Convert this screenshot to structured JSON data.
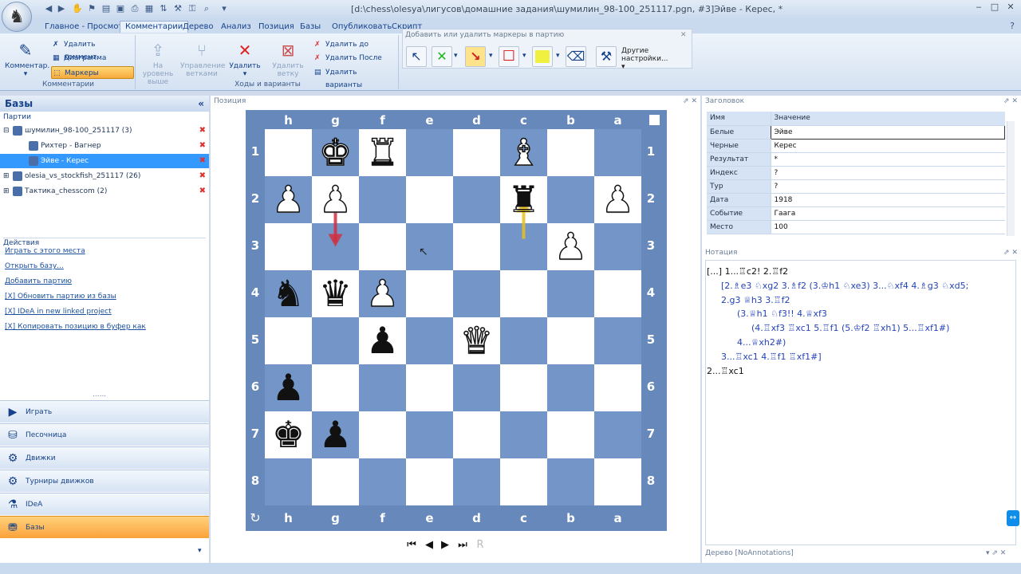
{
  "window": {
    "title": "[d:\\chess\\olesya\\лигусов\\домашние задания\\шумилин_98-100_251117.pgn, #3]Эйве - Керес, *",
    "min": "‒",
    "max": "□",
    "close": "✕"
  },
  "tabs": [
    "Главное - Просмотр",
    "Комментарии",
    "Дерево",
    "Анализ",
    "Позиция",
    "Базы",
    "Опубликовать",
    "Скрипт"
  ],
  "ribbon": {
    "comment_btn": "Комментар.",
    "delete_comment": "Удалить коммент.",
    "diagram": "Диаграмма",
    "markers": "Маркеры",
    "group_comments": "Комментарии",
    "to_level_up": "На уровень выше",
    "manage_branches": "Управление ветками",
    "delete": "Удалить",
    "delete_branch": "Удалить ветку",
    "delete_to": "Удалить до",
    "delete_after": "Удалить После",
    "delete_variants": "Удалить варианты",
    "group_moves": "Ходы и варианты",
    "marker_hint": "Добавить или удалить маркеры в партию",
    "other_settings": "Другие настройки..."
  },
  "left": {
    "title": "Базы",
    "collapse": "«",
    "games_label": "Партии",
    "tree": [
      {
        "label": "шумилин_98-100_251117 (3)",
        "indent": 0,
        "selected": false,
        "exp": "⊟"
      },
      {
        "label": "Рихтер - Вагнер",
        "indent": 1,
        "selected": false,
        "exp": ""
      },
      {
        "label": "Эйве - Керес",
        "indent": 1,
        "selected": true,
        "exp": ""
      },
      {
        "label": "olesia_vs_stockfish_251117 (26)",
        "indent": 0,
        "selected": false,
        "exp": "⊞"
      },
      {
        "label": "Тактика_chesscom (2)",
        "indent": 0,
        "selected": false,
        "exp": "⊞"
      }
    ],
    "actions_label": "Действия",
    "actions": [
      "Играть с этого места",
      "Открыть базу...",
      "Добавить партию",
      "[X] Обновить партию из базы",
      "[X] IDeA in new linked project",
      "[X] Копировать позицию в буфер как"
    ],
    "nav": [
      {
        "label": "Играть",
        "icon": "play-icon",
        "active": false
      },
      {
        "label": "Песочница",
        "icon": "sandbox-icon",
        "active": false
      },
      {
        "label": "Движки",
        "icon": "engines-icon",
        "active": false
      },
      {
        "label": "Турниры движков",
        "icon": "engine-tournaments-icon",
        "active": false
      },
      {
        "label": "IDeA",
        "icon": "idea-icon",
        "active": false
      },
      {
        "label": "Базы",
        "icon": "databases-icon",
        "active": true
      }
    ]
  },
  "center": {
    "title": "Позиция",
    "files": [
      "h",
      "g",
      "f",
      "e",
      "d",
      "c",
      "b",
      "a"
    ],
    "ranks": [
      "1",
      "2",
      "3",
      "4",
      "5",
      "6",
      "7",
      "8"
    ],
    "pieces": [
      {
        "sq": "g1",
        "p": "K",
        "c": "w"
      },
      {
        "sq": "f1",
        "p": "R",
        "c": "w"
      },
      {
        "sq": "c1",
        "p": "B",
        "c": "w"
      },
      {
        "sq": "h2",
        "p": "P",
        "c": "w"
      },
      {
        "sq": "g2",
        "p": "P",
        "c": "w"
      },
      {
        "sq": "c2",
        "p": "R",
        "c": "b"
      },
      {
        "sq": "a2",
        "p": "P",
        "c": "w"
      },
      {
        "sq": "b3",
        "p": "P",
        "c": "w"
      },
      {
        "sq": "h4",
        "p": "N",
        "c": "b"
      },
      {
        "sq": "g4",
        "p": "Q",
        "c": "b"
      },
      {
        "sq": "f4",
        "p": "P",
        "c": "w"
      },
      {
        "sq": "f5",
        "p": "P",
        "c": "b"
      },
      {
        "sq": "d5",
        "p": "Q",
        "c": "w"
      },
      {
        "sq": "h6",
        "p": "P",
        "c": "b"
      },
      {
        "sq": "h7",
        "p": "K",
        "c": "b"
      },
      {
        "sq": "g7",
        "p": "P",
        "c": "b"
      }
    ],
    "arrows": [
      {
        "from": "g2",
        "to": "g3",
        "color": "#d03040"
      },
      {
        "from": "c3",
        "to": "c2",
        "color": "#e8c020"
      }
    ]
  },
  "right": {
    "header_title": "Заголовок",
    "col_name": "Имя",
    "col_value": "Значение",
    "rows": [
      {
        "k": "Белые",
        "v": "Эйве"
      },
      {
        "k": "Черные",
        "v": "Керес"
      },
      {
        "k": "Результат",
        "v": "*"
      },
      {
        "k": "Индекс",
        "v": "?"
      },
      {
        "k": "Тур",
        "v": "?"
      },
      {
        "k": "Дата",
        "v": "1918"
      },
      {
        "k": "Событие",
        "v": "Гаага"
      },
      {
        "k": "Место",
        "v": "100"
      }
    ],
    "notation_title": "Нотация",
    "notation": [
      {
        "t": "[...] 1...♖c2! 2.♖f2",
        "x": 0,
        "var": false
      },
      {
        "t": "[2.♗e3 ♘xg2 3.♗f2 (3.♔h1 ♘xe3) 3...♘xf4 4.♗g3 ♘xd5;",
        "x": 18,
        "var": true
      },
      {
        "t": "2.g3 ♕h3 3.♖f2",
        "x": 18,
        "var": true
      },
      {
        "t": "(3.♕h1 ♘f3!! 4.♕xf3",
        "x": 38,
        "var": true
      },
      {
        "t": "(4.♖xf3 ♖xc1 5.♖f1 (5.♔f2 ♖xh1) 5...♖xf1#)",
        "x": 56,
        "var": true
      },
      {
        "t": "4...♕xh2#)",
        "x": 38,
        "var": true
      },
      {
        "t": "3...♖xc1 4.♖f1 ♖xf1#]",
        "x": 18,
        "var": true
      },
      {
        "t": "2...♖xc1",
        "x": 0,
        "var": false
      }
    ],
    "tree_footer": "Дерево [NoAnnotations]"
  },
  "colors": {
    "accent": "#f7a93b",
    "board_dark": "#7395c8",
    "board_light": "#ffffff",
    "selection": "#3399ff"
  }
}
